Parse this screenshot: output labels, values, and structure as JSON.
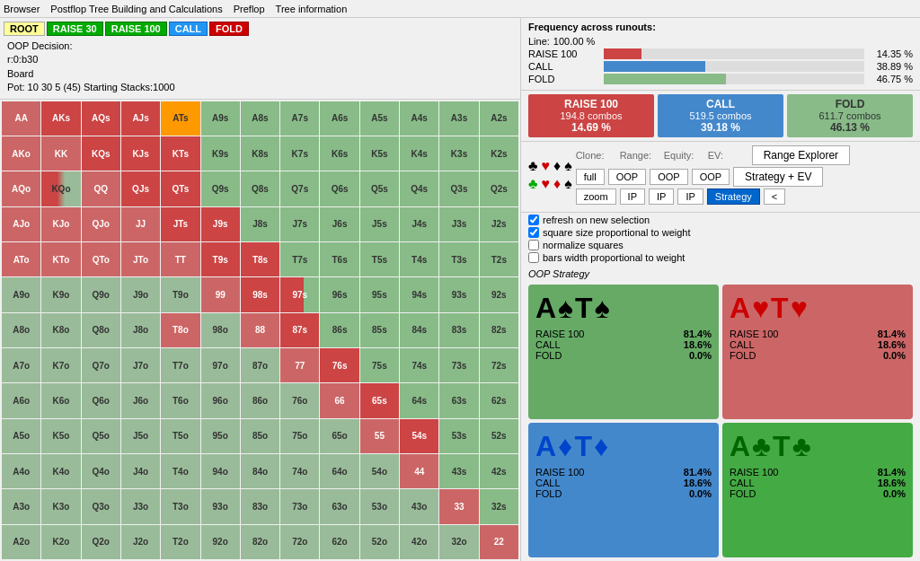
{
  "menu": {
    "items": [
      "Browser",
      "Postflop Tree Building and Calculations",
      "Preflop",
      "Tree information"
    ]
  },
  "header": {
    "breadcrumbs": [
      "ROOT",
      "RAISE 30",
      "RAISE 100",
      "CALL",
      "FOLD"
    ],
    "oop_decision": "OOP Decision:",
    "line": "r:0:b30",
    "board": "Board",
    "pot": "Pot: 10 30 5 (45) Starting Stacks:1000"
  },
  "frequency": {
    "title": "Frequency across runouts:",
    "line_label": "Line:",
    "line_value": "100.00 %",
    "items": [
      {
        "label": "RAISE 100",
        "value": "14.35 %",
        "pct": 14.35
      },
      {
        "label": "CALL",
        "value": "38.89 %",
        "pct": 38.89
      },
      {
        "label": "FOLD",
        "value": "46.75 %",
        "pct": 46.75
      }
    ]
  },
  "action_blocks": [
    {
      "id": "raise100",
      "label": "RAISE 100",
      "combos": "194.8 combos",
      "pct": "14.69 %"
    },
    {
      "id": "call",
      "label": "CALL",
      "combos": "519.5 combos",
      "pct": "39.18 %"
    },
    {
      "id": "fold",
      "label": "FOLD",
      "combos": "611.7 combos",
      "pct": "46.13 %"
    }
  ],
  "controls": {
    "clone_label": "Clone:",
    "range_label": "Range:",
    "equity_label": "Equity:",
    "ev_label": "EV:",
    "full_btn": "full",
    "zoom_btn": "zoom",
    "oop_btn": "OOP",
    "ip_btn": "IP",
    "range_explorer_btn": "Range Explorer",
    "strategy_ev_btn": "Strategy + EV",
    "strategy_btn": "Strategy",
    "arrow_btn": "<"
  },
  "checkboxes": [
    {
      "label": "refresh on new selection",
      "checked": true
    },
    {
      "label": "square size proportional to weight",
      "checked": true
    },
    {
      "label": "normalize squares",
      "checked": false
    },
    {
      "label": "bars width proportional to weight",
      "checked": false
    }
  ],
  "oop_strategy_label": "OOP Strategy",
  "combo_panels": [
    {
      "id": "spade",
      "suit_color": "black",
      "cards": "A♠T♠",
      "stats": [
        {
          "label": "RAISE 100",
          "value": "81.4%"
        },
        {
          "label": "CALL",
          "value": "18.6%"
        },
        {
          "label": "FOLD",
          "value": "0.0%"
        }
      ]
    },
    {
      "id": "heart",
      "suit_color": "red",
      "cards": "A♥T♥",
      "stats": [
        {
          "label": "RAISE 100",
          "value": "81.4%"
        },
        {
          "label": "CALL",
          "value": "18.6%"
        },
        {
          "label": "FOLD",
          "value": "0.0%"
        }
      ]
    },
    {
      "id": "diamond",
      "suit_color": "blue",
      "cards": "A♦T♦",
      "stats": [
        {
          "label": "RAISE 100",
          "value": "81.4%"
        },
        {
          "label": "CALL",
          "value": "18.6%"
        },
        {
          "label": "FOLD",
          "value": "0.0%"
        }
      ]
    },
    {
      "id": "club",
      "suit_color": "green",
      "cards": "A♣T♣",
      "stats": [
        {
          "label": "RAISE 100",
          "value": "81.4%"
        },
        {
          "label": "CALL",
          "value": "18.6%"
        },
        {
          "label": "FOLD",
          "value": "0.0%"
        }
      ]
    }
  ],
  "grid_rows": [
    [
      "AA",
      "AKs",
      "AQs",
      "AJs",
      "ATs",
      "A9s",
      "A8s",
      "A7s",
      "A6s",
      "A5s",
      "A4s",
      "A3s",
      "A2s"
    ],
    [
      "AKo",
      "KK",
      "KQs",
      "KJs",
      "KTs",
      "K9s",
      "K8s",
      "K7s",
      "K6s",
      "K5s",
      "K4s",
      "K3s",
      "K2s"
    ],
    [
      "AQo",
      "KQo",
      "QQ",
      "QJs",
      "QTs",
      "Q9s",
      "Q8s",
      "Q7s",
      "Q6s",
      "Q5s",
      "Q4s",
      "Q3s",
      "Q2s"
    ],
    [
      "AJo",
      "KJo",
      "QJo",
      "JJ",
      "JTs",
      "J9s",
      "J8s",
      "J7s",
      "J6s",
      "J5s",
      "J4s",
      "J3s",
      "J2s"
    ],
    [
      "ATo",
      "KTo",
      "QTo",
      "JTo",
      "TT",
      "T9s",
      "T8s",
      "T7s",
      "T6s",
      "T5s",
      "T4s",
      "T3s",
      "T2s"
    ],
    [
      "A9o",
      "K9o",
      "Q9o",
      "J9o",
      "T9o",
      "99",
      "98s",
      "97s",
      "96s",
      "95s",
      "94s",
      "93s",
      "92s"
    ],
    [
      "A8o",
      "K8o",
      "Q8o",
      "J8o",
      "T8o",
      "98o",
      "88",
      "87s",
      "86s",
      "85s",
      "84s",
      "83s",
      "82s"
    ],
    [
      "A7o",
      "K7o",
      "Q7o",
      "J7o",
      "T7o",
      "97o",
      "87o",
      "77",
      "76s",
      "75s",
      "74s",
      "73s",
      "72s"
    ],
    [
      "A6o",
      "K6o",
      "Q6o",
      "J6o",
      "T6o",
      "96o",
      "86o",
      "76o",
      "66",
      "65s",
      "64s",
      "63s",
      "62s"
    ],
    [
      "A5o",
      "K5o",
      "Q5o",
      "J5o",
      "T5o",
      "95o",
      "85o",
      "75o",
      "65o",
      "55",
      "54s",
      "53s",
      "52s"
    ],
    [
      "A4o",
      "K4o",
      "Q4o",
      "J4o",
      "T4o",
      "94o",
      "84o",
      "74o",
      "64o",
      "54o",
      "44",
      "43s",
      "42s"
    ],
    [
      "A3o",
      "K3o",
      "Q3o",
      "J3o",
      "T3o",
      "93o",
      "83o",
      "73o",
      "63o",
      "53o",
      "43o",
      "33",
      "32s"
    ],
    [
      "A2o",
      "K2o",
      "Q2o",
      "J2o",
      "T2o",
      "92o",
      "82o",
      "72o",
      "62o",
      "52o",
      "42o",
      "32o",
      "22"
    ]
  ],
  "grid_colors": [
    [
      "pp-r",
      "s-r",
      "s-r",
      "s-r",
      "s-hl",
      "s-g",
      "s-g",
      "s-g",
      "s-g",
      "s-g",
      "s-g",
      "s-g",
      "s-g"
    ],
    [
      "o-r",
      "pp-r",
      "s-r",
      "s-r",
      "s-r",
      "s-g",
      "s-g",
      "s-g",
      "s-g",
      "s-g",
      "s-g",
      "s-g",
      "s-g"
    ],
    [
      "o-r",
      "o-m",
      "pp-r",
      "s-r",
      "s-r",
      "s-g",
      "s-g",
      "s-g",
      "s-g",
      "s-g",
      "s-g",
      "s-g",
      "s-g"
    ],
    [
      "o-r",
      "o-r",
      "o-r",
      "pp-r",
      "s-r",
      "s-r",
      "s-g",
      "s-g",
      "s-g",
      "s-g",
      "s-g",
      "s-g",
      "s-g"
    ],
    [
      "o-r",
      "o-r",
      "o-r",
      "o-r",
      "pp-r",
      "s-r",
      "s-r",
      "s-g",
      "s-g",
      "s-g",
      "s-g",
      "s-g",
      "s-g"
    ],
    [
      "o-g",
      "o-g",
      "o-g",
      "o-g",
      "o-g",
      "pp-r",
      "s-r",
      "s-m",
      "s-g",
      "s-g",
      "s-g",
      "s-g",
      "s-g"
    ],
    [
      "o-g",
      "o-g",
      "o-g",
      "o-g",
      "o-r",
      "o-g",
      "pp-r",
      "s-r",
      "s-g",
      "s-g",
      "s-g",
      "s-g",
      "s-g"
    ],
    [
      "o-g",
      "o-g",
      "o-g",
      "o-g",
      "o-g",
      "o-g",
      "o-g",
      "pp-r",
      "s-r",
      "s-g",
      "s-g",
      "s-g",
      "s-g"
    ],
    [
      "o-g",
      "o-g",
      "o-g",
      "o-g",
      "o-g",
      "o-g",
      "o-g",
      "o-g",
      "pp-r",
      "s-r",
      "s-g",
      "s-g",
      "s-g"
    ],
    [
      "o-g",
      "o-g",
      "o-g",
      "o-g",
      "o-g",
      "o-g",
      "o-g",
      "o-g",
      "o-g",
      "pp-r",
      "s-r",
      "s-g",
      "s-g"
    ],
    [
      "o-g",
      "o-g",
      "o-g",
      "o-g",
      "o-g",
      "o-g",
      "o-g",
      "o-g",
      "o-g",
      "o-g",
      "pp-r",
      "s-g",
      "s-g"
    ],
    [
      "o-g",
      "o-g",
      "o-g",
      "o-g",
      "o-g",
      "o-g",
      "o-g",
      "o-g",
      "o-g",
      "o-g",
      "o-g",
      "pp-r",
      "s-g"
    ],
    [
      "o-g",
      "o-g",
      "o-g",
      "o-g",
      "o-g",
      "o-g",
      "o-g",
      "o-g",
      "o-g",
      "o-g",
      "o-g",
      "o-g",
      "pp-r"
    ]
  ]
}
